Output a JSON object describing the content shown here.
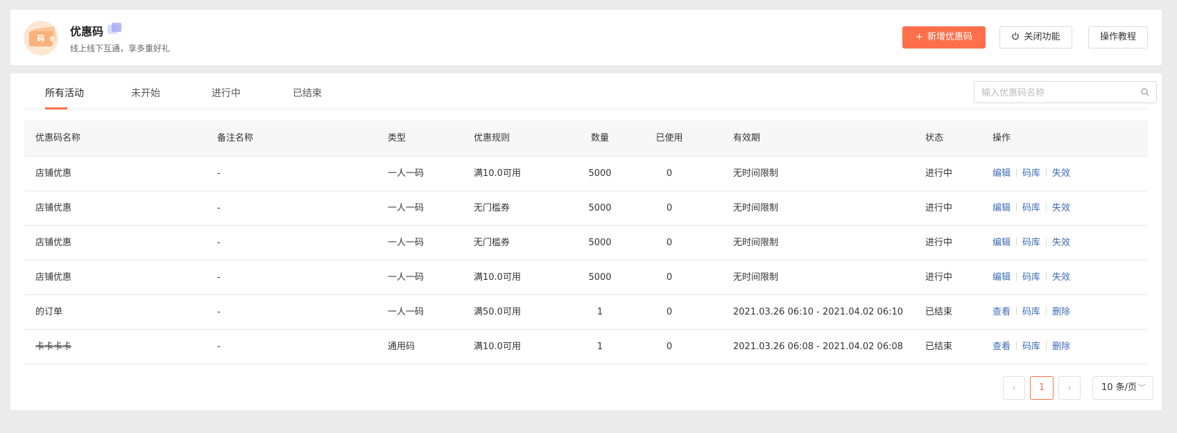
{
  "header": {
    "title": "优惠码",
    "subtitle": "线上线下互通，享多重好礼",
    "logo_glyph": "码",
    "logo_icon": "coupon-ticket-icon",
    "buttons": {
      "add_label": "新增优惠码",
      "add_icon": "plus-icon",
      "close_label": "关闭功能",
      "close_icon": "power-icon",
      "tutorial_label": "操作教程"
    }
  },
  "colors": {
    "accent": "#ff6f4a",
    "link": "#3d6bb5",
    "badge_light": "#d9dcff",
    "badge_dark": "#a7adf5"
  },
  "tabs": [
    {
      "label": "所有活动",
      "active": true
    },
    {
      "label": "未开始",
      "active": false
    },
    {
      "label": "进行中",
      "active": false
    },
    {
      "label": "已结束",
      "active": false
    }
  ],
  "search": {
    "placeholder": "输入优惠码名称",
    "value": "",
    "icon": "search-icon"
  },
  "table": {
    "columns": [
      "优惠码名称",
      "备注名称",
      "类型",
      "优惠规则",
      "数量",
      "已使用",
      "有效期",
      "状态",
      "操作"
    ],
    "rows": [
      {
        "name": "店铺优惠",
        "remark": "-",
        "type": "一人一码",
        "rule": "满10.0可用",
        "quantity": "5000",
        "used": "0",
        "validity": "无时间限制",
        "status": "进行中",
        "actions": [
          "编辑",
          "码库",
          "失效"
        ]
      },
      {
        "name": "店铺优惠",
        "remark": "-",
        "type": "一人一码",
        "rule": "无门槛券",
        "quantity": "5000",
        "used": "0",
        "validity": "无时间限制",
        "status": "进行中",
        "actions": [
          "编辑",
          "码库",
          "失效"
        ]
      },
      {
        "name": "店铺优惠",
        "remark": "-",
        "type": "一人一码",
        "rule": "无门槛券",
        "quantity": "5000",
        "used": "0",
        "validity": "无时间限制",
        "status": "进行中",
        "actions": [
          "编辑",
          "码库",
          "失效"
        ]
      },
      {
        "name": "店铺优惠",
        "remark": "-",
        "type": "一人一码",
        "rule": "满10.0可用",
        "quantity": "5000",
        "used": "0",
        "validity": "无时间限制",
        "status": "进行中",
        "actions": [
          "编辑",
          "码库",
          "失效"
        ]
      },
      {
        "name": "的订单",
        "remark": "-",
        "type": "一人一码",
        "rule": "满50.0可用",
        "quantity": "1",
        "used": "0",
        "validity": "2021.03.26 06:10 - 2021.04.02 06:10",
        "status": "已结束",
        "actions": [
          "查看",
          "码库",
          "删除"
        ]
      },
      {
        "name": "卡卡卡卡",
        "remark": "-",
        "type": "通用码",
        "rule": "满10.0可用",
        "quantity": "1",
        "used": "0",
        "validity": "2021.03.26 06:08 - 2021.04.02 06:08",
        "status": "已结束",
        "actions": [
          "查看",
          "码库",
          "删除"
        ],
        "strikethrough": true
      }
    ]
  },
  "pagination": {
    "prev_icon": "chevron-left-icon",
    "next_icon": "chevron-right-icon",
    "current_page": "1",
    "page_size_label": "10 条/页",
    "page_size_icon": "chevron-down-icon"
  }
}
